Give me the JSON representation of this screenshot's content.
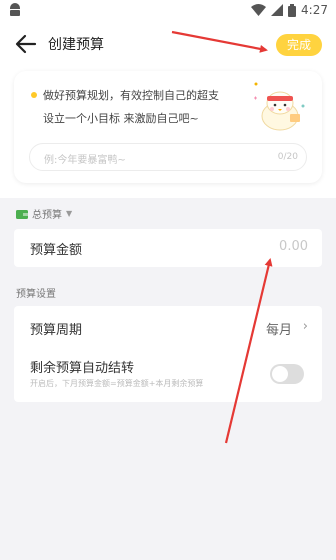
{
  "status_bar": {
    "time": "4:27"
  },
  "header": {
    "title": "创建预算",
    "done_label": "完成"
  },
  "intro": {
    "tip_line1": "做好预算规划，有效控制自己的超支",
    "tip_line2": "设立一个小目标 来激励自己吧~",
    "goal_placeholder": "例:今年要暴富鸭~",
    "goal_char_count": "0/20"
  },
  "budget": {
    "total_label": "总预算",
    "amount_label": "预算金额",
    "amount_value": "0.00"
  },
  "settings": {
    "section_label": "预算设置",
    "period_label": "预算周期",
    "period_value": "每月",
    "carryover_label": "剩余预算自动结转",
    "carryover_desc": "开启后，下月预算金额=预算金额+本月剩余预算",
    "carryover_enabled": false
  },
  "colors": {
    "accent": "#ffd33f",
    "annotation": "#e53935"
  }
}
